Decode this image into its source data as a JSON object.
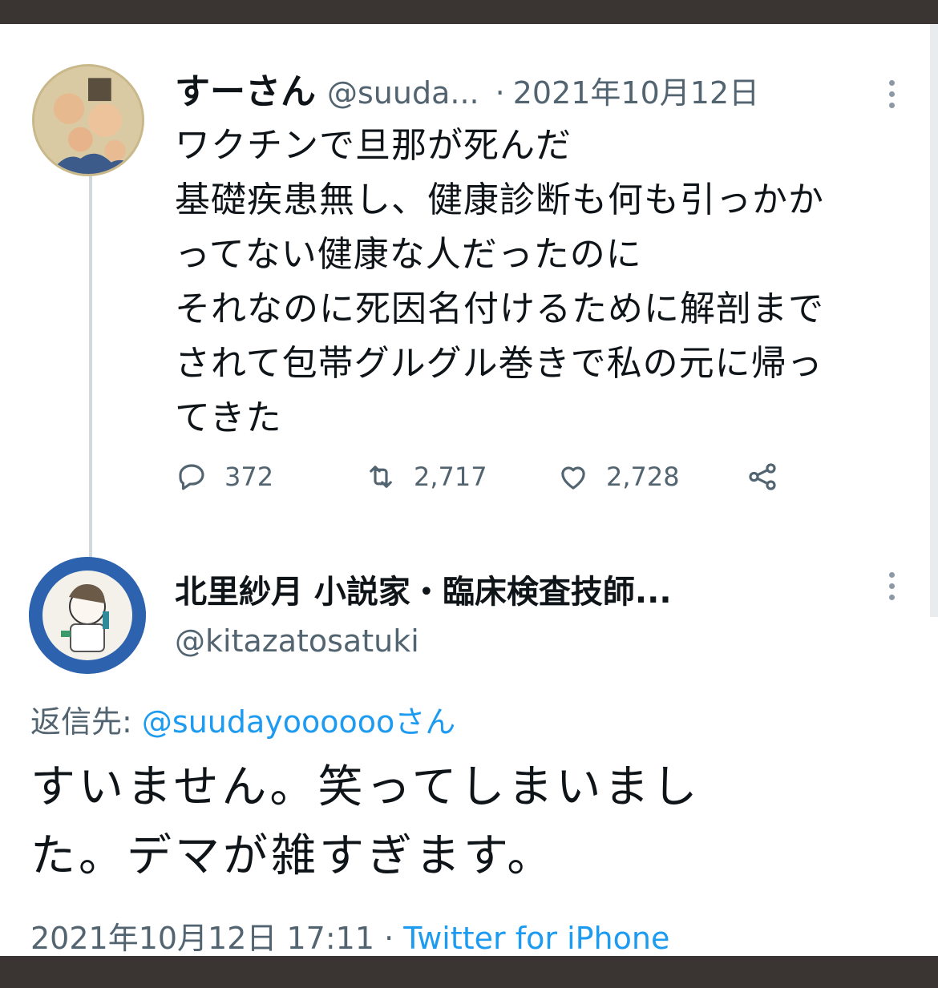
{
  "tweet1": {
    "name": "すーさん",
    "handle": "@suuda...",
    "separator": "·",
    "date": "2021年10月12日",
    "lines": [
      "ワクチンで旦那が死んだ",
      "基礎疾患無し、健康診断も何も引っかか",
      "ってない健康な人だったのに",
      "それなのに死因名付けるために解剖まで",
      "されて包帯グルグル巻きで私の元に帰っ",
      "てきた"
    ],
    "actions": {
      "reply_icon": "comment-icon",
      "reply_count": "372",
      "retweet_icon": "retweet-icon",
      "retweet_count": "2,717",
      "like_icon": "heart-icon",
      "like_count": "2,728",
      "share_icon": "share-icon"
    }
  },
  "tweet2": {
    "name": "北里紗月 小説家・臨床検査技師...",
    "handle": "@kitazatosatuki",
    "reply_prefix": "返信先:",
    "reply_target": "@suudayoooooo",
    "reply_suffix": "さん",
    "lines": [
      "すいません。笑ってしまいまし",
      "た。デマが雑すぎます。"
    ],
    "timestamp": "2021年10月12日 17:11",
    "separator": "·",
    "source": "Twitter for iPhone"
  },
  "colors": {
    "text": "#0f1419",
    "muted": "#536471",
    "link": "#1d9bf0",
    "frame": "#3a3533"
  }
}
